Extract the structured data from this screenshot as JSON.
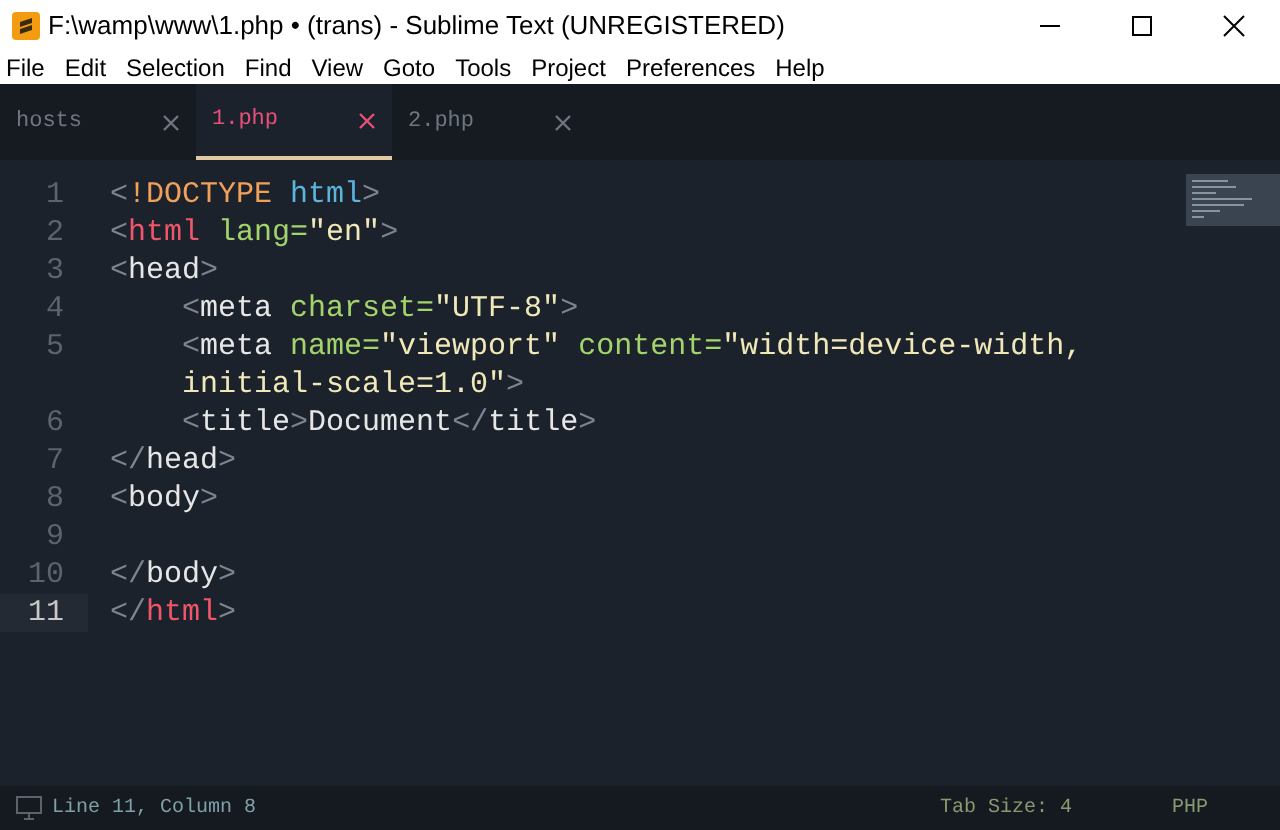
{
  "window": {
    "title": "F:\\wamp\\www\\1.php • (trans) - Sublime Text (UNREGISTERED)"
  },
  "menu": [
    "File",
    "Edit",
    "Selection",
    "Find",
    "View",
    "Goto",
    "Tools",
    "Project",
    "Preferences",
    "Help"
  ],
  "tabs": [
    {
      "label": "hosts",
      "selected": false
    },
    {
      "label": "1.php",
      "selected": true
    },
    {
      "label": "2.php",
      "selected": false
    }
  ],
  "code": [
    {
      "number": "1",
      "current": false,
      "rows": [
        {
          "tokens": [
            {
              "kind": "punct",
              "text": "<"
            },
            {
              "kind": "doctype",
              "text": "!DOCTYPE"
            },
            {
              "kind": "keyword",
              "text": " html"
            },
            {
              "kind": "punct",
              "text": ">"
            }
          ]
        }
      ]
    },
    {
      "number": "2",
      "current": false,
      "rows": [
        {
          "tokens": [
            {
              "kind": "punct",
              "text": "<"
            },
            {
              "kind": "tag",
              "text": "html"
            },
            {
              "kind": "attr",
              "text": " lang="
            },
            {
              "kind": "string",
              "text": "\"en\""
            },
            {
              "kind": "punct",
              "text": ">"
            }
          ]
        }
      ]
    },
    {
      "number": "3",
      "current": false,
      "rows": [
        {
          "tokens": [
            {
              "kind": "punct",
              "text": "<"
            },
            {
              "kind": "plain",
              "text": "head"
            },
            {
              "kind": "punct",
              "text": ">"
            }
          ]
        }
      ],
      "children": [
        {
          "number": "4",
          "current": false,
          "rows": [
            {
              "tokens": [
                {
                  "kind": "punct",
                  "text": "<"
                },
                {
                  "kind": "plain",
                  "text": "meta"
                },
                {
                  "kind": "attr",
                  "text": " charset="
                },
                {
                  "kind": "string",
                  "text": "\"UTF-8\""
                },
                {
                  "kind": "punct",
                  "text": ">"
                }
              ]
            }
          ]
        },
        {
          "number": "5",
          "current": false,
          "rows": [
            {
              "tokens": [
                {
                  "kind": "punct",
                  "text": "<"
                },
                {
                  "kind": "plain",
                  "text": "meta"
                },
                {
                  "kind": "attr",
                  "text": " name="
                },
                {
                  "kind": "string",
                  "text": "\"viewport\""
                },
                {
                  "kind": "attr",
                  "text": " content="
                },
                {
                  "kind": "string",
                  "text": "\"width=device-width,"
                }
              ]
            },
            {
              "tokens": [
                {
                  "kind": "string",
                  "text": "initial-scale=1.0\""
                },
                {
                  "kind": "punct",
                  "text": ">"
                }
              ]
            }
          ]
        },
        {
          "number": "6",
          "current": false,
          "rows": [
            {
              "tokens": [
                {
                  "kind": "punct",
                  "text": "<"
                },
                {
                  "kind": "plain",
                  "text": "title"
                },
                {
                  "kind": "punct",
                  "text": ">"
                },
                {
                  "kind": "plain",
                  "text": "Document"
                },
                {
                  "kind": "punct",
                  "text": "</"
                },
                {
                  "kind": "plain",
                  "text": "title"
                },
                {
                  "kind": "punct",
                  "text": ">"
                }
              ]
            }
          ]
        }
      ]
    },
    {
      "number": "7",
      "current": false,
      "rows": [
        {
          "tokens": [
            {
              "kind": "punct",
              "text": "</"
            },
            {
              "kind": "plain",
              "text": "head"
            },
            {
              "kind": "punct",
              "text": ">"
            }
          ]
        }
      ]
    },
    {
      "number": "8",
      "current": false,
      "rows": [
        {
          "tokens": [
            {
              "kind": "punct",
              "text": "<"
            },
            {
              "kind": "plain",
              "text": "body"
            },
            {
              "kind": "punct",
              "text": ">"
            }
          ]
        }
      ]
    },
    {
      "number": "9",
      "current": false
    },
    {
      "number": "10",
      "current": false,
      "rows": [
        {
          "tokens": [
            {
              "kind": "punct",
              "text": "</"
            },
            {
              "kind": "plain",
              "text": "body"
            },
            {
              "kind": "punct",
              "text": ">"
            }
          ]
        }
      ]
    },
    {
      "number": "11",
      "current": true,
      "rows": [
        {
          "tokens": [
            {
              "kind": "punct",
              "text": "</"
            },
            {
              "kind": "tag",
              "text": "html"
            },
            {
              "kind": "punct",
              "text": ">"
            }
          ]
        }
      ]
    }
  ],
  "status_bar": {
    "position": "Line 11, Column 8",
    "tab_size": "Tab Size: 4",
    "syntax": "PHP"
  }
}
